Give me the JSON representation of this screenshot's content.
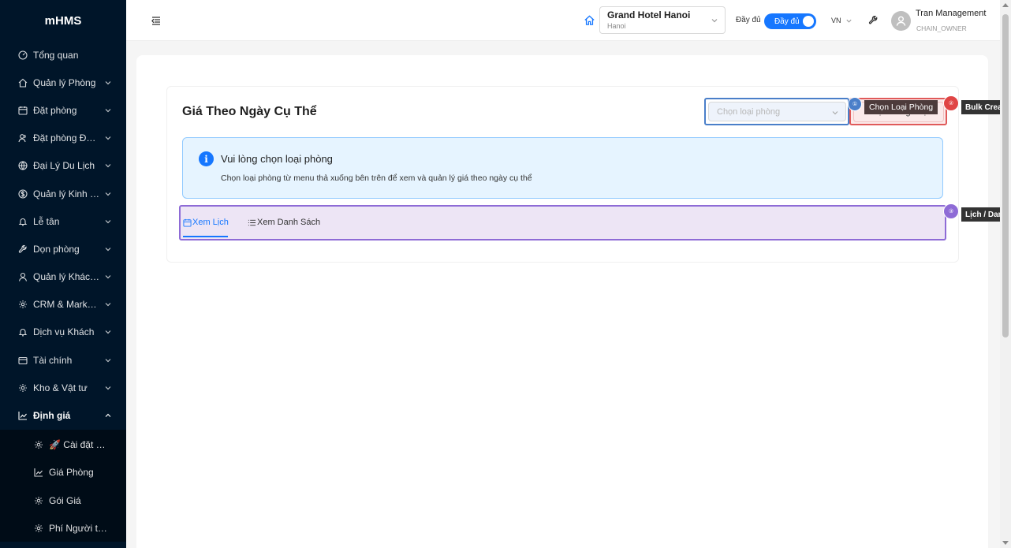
{
  "app": {
    "logo": "mHMS"
  },
  "sidebar": {
    "items": [
      {
        "label": "Tổng quan",
        "icon": "dashboard-icon",
        "has_arrow": false
      },
      {
        "label": "Quản lý Phòng",
        "icon": "home-icon",
        "has_arrow": true
      },
      {
        "label": "Đặt phòng",
        "icon": "calendar-icon",
        "has_arrow": true
      },
      {
        "label": "Đặt phòng Đoàn",
        "icon": "users-icon",
        "has_arrow": true
      },
      {
        "label": "Đại Lý Du Lịch",
        "icon": "globe-icon",
        "has_arrow": true
      },
      {
        "label": "Quản lý Kinh D...",
        "icon": "dollar-icon",
        "has_arrow": true
      },
      {
        "label": "Lễ tân",
        "icon": "bell-icon",
        "has_arrow": true
      },
      {
        "label": "Dọn phòng",
        "icon": "wrench-icon",
        "has_arrow": true
      },
      {
        "label": "Quản lý Khách ...",
        "icon": "user-icon",
        "has_arrow": true
      },
      {
        "label": "CRM & Marketi...",
        "icon": "gear-icon",
        "has_arrow": true
      },
      {
        "label": "Dịch vụ Khách",
        "icon": "bell-icon",
        "has_arrow": true
      },
      {
        "label": "Tài chính",
        "icon": "wallet-icon",
        "has_arrow": true
      },
      {
        "label": "Kho & Vật tư",
        "icon": "gear-icon",
        "has_arrow": true
      }
    ],
    "open_item": {
      "label": "Định giá",
      "icon": "chart-icon"
    },
    "sub_items": [
      {
        "label": "🚀 Cài đặt Nh...",
        "icon": "gear-icon"
      },
      {
        "label": "Giá Phòng",
        "icon": "chart-icon"
      },
      {
        "label": "Gói Giá",
        "icon": "gear-icon"
      },
      {
        "label": "Phí Người thêm",
        "icon": "gear-icon"
      }
    ]
  },
  "header": {
    "hotel_name": "Grand Hotel Hanoi",
    "hotel_city": "Hanoi",
    "full_label": "Đầy đủ",
    "toggle_label": "Đầy đủ",
    "lang": "VN",
    "user_name": "Tran Management",
    "user_role": "CHAIN_OWNER"
  },
  "page": {
    "title": "Giá Theo Ngày Cụ Thể",
    "room_select_placeholder": "Chọn loại phòng",
    "bulk_button": "+ Tạo Hàng Loạt",
    "alert_title": "Vui lòng chọn loại phòng",
    "alert_desc": "Chọn loại phòng từ menu thả xuống bên trên để xem và quản lý giá theo ngày cụ thể",
    "tabs": [
      "Xem Lịch",
      "Xem Danh Sách"
    ]
  },
  "annotations": {
    "room_badge": "①",
    "room_tip": "Chọn Loại Phòng",
    "bulk_badge": "②",
    "bulk_tip": "Bulk Crea",
    "view_badge": "③",
    "view_tip": "Lịch / Dan"
  },
  "colors": {
    "sidebar_bg": "#001529",
    "primary": "#1677ff",
    "highlight_blue": "#4a7fc9",
    "highlight_red": "#e05a5a",
    "highlight_purple": "#8e6bd6"
  }
}
